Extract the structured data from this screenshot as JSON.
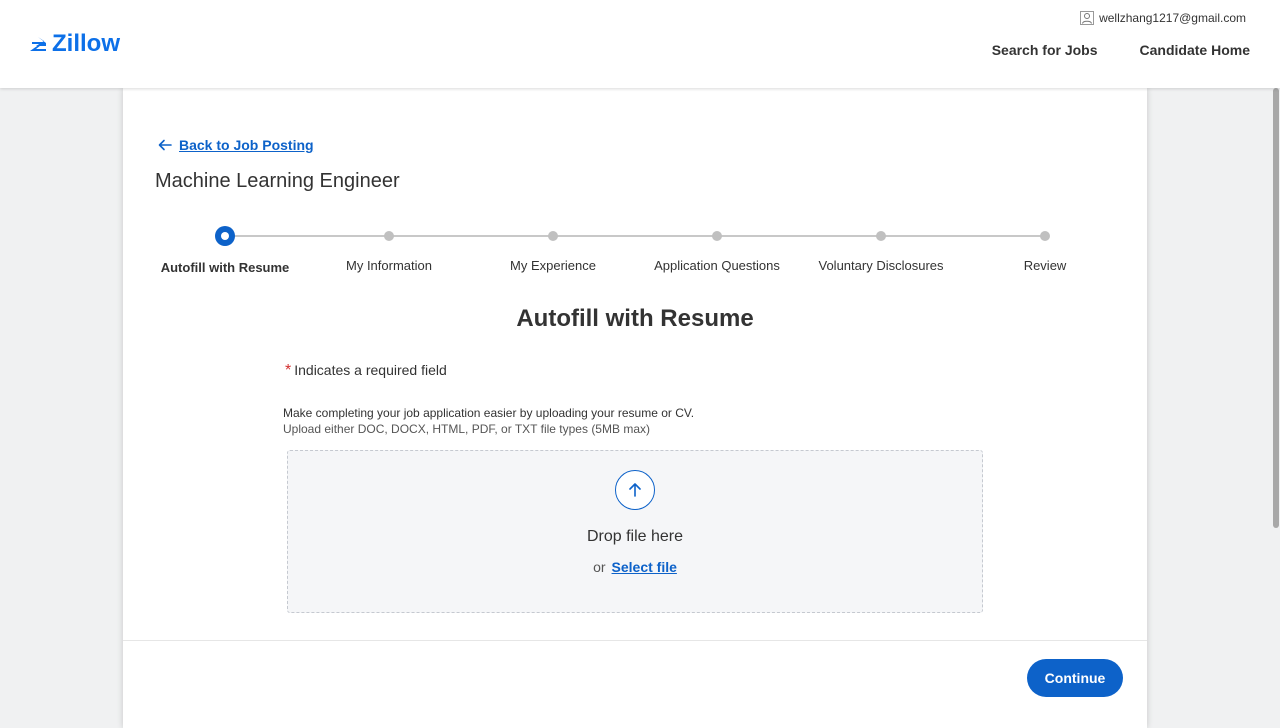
{
  "header": {
    "logo_text": "Zillow",
    "user_email": "wellzhang1217@gmail.com",
    "nav": [
      "Search for Jobs",
      "Candidate Home"
    ]
  },
  "back_link": "Back to Job Posting",
  "job_title": "Machine Learning Engineer",
  "steps": [
    {
      "label": "Autofill with Resume",
      "active": true
    },
    {
      "label": "My Information",
      "active": false
    },
    {
      "label": "My Experience",
      "active": false
    },
    {
      "label": "Application Questions",
      "active": false
    },
    {
      "label": "Voluntary Disclosures",
      "active": false
    },
    {
      "label": "Review",
      "active": false
    }
  ],
  "section_title": "Autofill with Resume",
  "required_note": "Indicates a required field",
  "required_marker": "*",
  "intro_text": "Make completing your job application easier by uploading your resume or CV.",
  "file_hint": "Upload either DOC, DOCX, HTML, PDF, or TXT file types (5MB max)",
  "dropzone": {
    "drop_text": "Drop file here",
    "or_text": "or",
    "select_label": "Select file"
  },
  "continue_label": "Continue",
  "colors": {
    "brand": "#0d70e8",
    "accent": "#0d62c9",
    "required": "#d32f2f"
  }
}
